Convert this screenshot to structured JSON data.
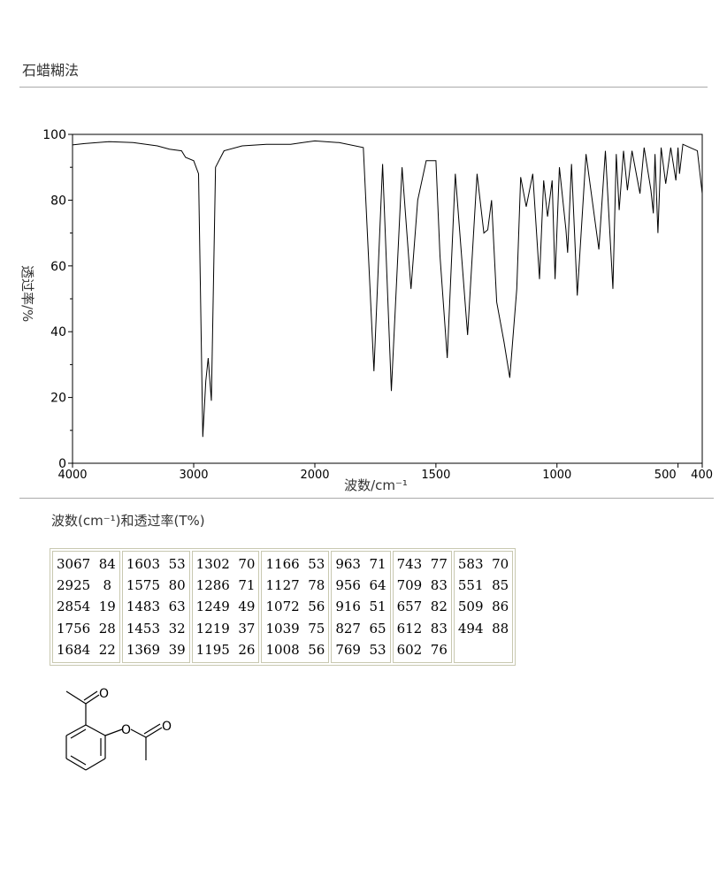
{
  "method": "石蜡糊法",
  "table_title": "波数(cm⁻¹)和透过率(T%)",
  "peak_table": [
    [
      [
        "3067",
        "84"
      ],
      [
        "2925",
        "8"
      ],
      [
        "2854",
        "19"
      ],
      [
        "1756",
        "28"
      ],
      [
        "1684",
        "22"
      ]
    ],
    [
      [
        "1603",
        "53"
      ],
      [
        "1575",
        "80"
      ],
      [
        "1483",
        "63"
      ],
      [
        "1453",
        "32"
      ],
      [
        "1369",
        "39"
      ]
    ],
    [
      [
        "1302",
        "70"
      ],
      [
        "1286",
        "71"
      ],
      [
        "1249",
        "49"
      ],
      [
        "1219",
        "37"
      ],
      [
        "1195",
        "26"
      ]
    ],
    [
      [
        "1166",
        "53"
      ],
      [
        "1127",
        "78"
      ],
      [
        "1072",
        "56"
      ],
      [
        "1039",
        "75"
      ],
      [
        "1008",
        "56"
      ]
    ],
    [
      [
        "963",
        "71"
      ],
      [
        "956",
        "64"
      ],
      [
        "916",
        "51"
      ],
      [
        "827",
        "65"
      ],
      [
        "769",
        "53"
      ]
    ],
    [
      [
        "743",
        "77"
      ],
      [
        "709",
        "83"
      ],
      [
        "657",
        "82"
      ],
      [
        "612",
        "83"
      ],
      [
        "602",
        "76"
      ]
    ],
    [
      [
        "583",
        "70"
      ],
      [
        "551",
        "85"
      ],
      [
        "509",
        "86"
      ],
      [
        "494",
        "88"
      ]
    ]
  ],
  "chart_data": {
    "type": "line",
    "xlabel": "波数/cm⁻¹",
    "ylabel": "透过率/%",
    "xlim": [
      4000,
      400
    ],
    "ylim": [
      0,
      100
    ],
    "x_ticks": [
      "4000",
      "3000",
      "2000",
      "1500",
      "1000",
      "500",
      "400"
    ],
    "y_ticks": [
      "0",
      "20",
      "40",
      "60",
      "80",
      "100"
    ],
    "x_axis_segments": [
      {
        "from": 4000,
        "to": 2000
      },
      {
        "from": 2000,
        "to": 400
      }
    ],
    "baseline": [
      [
        4000,
        96.8
      ],
      [
        3900,
        97.2
      ],
      [
        3700,
        97.8
      ],
      [
        3500,
        97.5
      ],
      [
        3300,
        96.5
      ],
      [
        3200,
        95.5
      ],
      [
        3100,
        95
      ],
      [
        3067,
        93
      ],
      [
        3000,
        92
      ],
      [
        2960,
        88
      ],
      [
        2925,
        8
      ],
      [
        2900,
        25
      ],
      [
        2880,
        32
      ],
      [
        2854,
        19
      ],
      [
        2820,
        90
      ],
      [
        2750,
        95
      ],
      [
        2600,
        96.5
      ],
      [
        2400,
        97
      ],
      [
        2200,
        97
      ],
      [
        2100,
        97.5
      ],
      [
        2000,
        98
      ],
      [
        1900,
        97.5
      ],
      [
        1800,
        96
      ],
      [
        1756,
        28
      ],
      [
        1720,
        91
      ],
      [
        1684,
        22
      ],
      [
        1640,
        90
      ],
      [
        1603,
        53
      ],
      [
        1575,
        80
      ],
      [
        1540,
        92
      ],
      [
        1500,
        92
      ],
      [
        1483,
        63
      ],
      [
        1453,
        32
      ],
      [
        1420,
        88
      ],
      [
        1369,
        39
      ],
      [
        1330,
        88
      ],
      [
        1302,
        70
      ],
      [
        1286,
        71
      ],
      [
        1270,
        80
      ],
      [
        1249,
        49
      ],
      [
        1219,
        37
      ],
      [
        1195,
        26
      ],
      [
        1166,
        53
      ],
      [
        1150,
        87
      ],
      [
        1127,
        78
      ],
      [
        1100,
        88
      ],
      [
        1072,
        56
      ],
      [
        1055,
        86
      ],
      [
        1039,
        75
      ],
      [
        1020,
        86
      ],
      [
        1008,
        56
      ],
      [
        990,
        90
      ],
      [
        963,
        71
      ],
      [
        956,
        64
      ],
      [
        940,
        91
      ],
      [
        916,
        51
      ],
      [
        880,
        94
      ],
      [
        827,
        65
      ],
      [
        800,
        95
      ],
      [
        769,
        53
      ],
      [
        755,
        94
      ],
      [
        743,
        77
      ],
      [
        725,
        95
      ],
      [
        709,
        83
      ],
      [
        690,
        95
      ],
      [
        657,
        82
      ],
      [
        640,
        96
      ],
      [
        612,
        83
      ],
      [
        602,
        76
      ],
      [
        595,
        94
      ],
      [
        583,
        70
      ],
      [
        570,
        96
      ],
      [
        551,
        85
      ],
      [
        530,
        96
      ],
      [
        509,
        86
      ],
      [
        500,
        96
      ],
      [
        494,
        88
      ],
      [
        480,
        97
      ],
      [
        450,
        96
      ],
      [
        420,
        95
      ],
      [
        400,
        82
      ]
    ]
  },
  "molecule": {
    "name": "2-acetylphenyl acetate",
    "atom_labels": [
      "O",
      "O",
      "O"
    ]
  }
}
